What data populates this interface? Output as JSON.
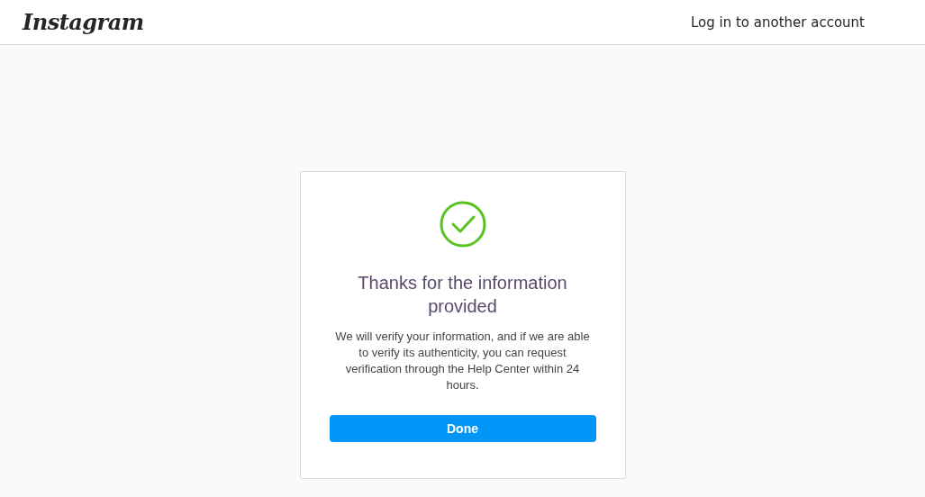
{
  "header": {
    "logo": "Instagram",
    "link": "Log in to another account"
  },
  "card": {
    "title": "Thanks for the information provided",
    "message": "We will verify your information, and if we are able to verify its authenticity, you can request verification through the Help Center within 24 hours.",
    "button": "Done"
  }
}
